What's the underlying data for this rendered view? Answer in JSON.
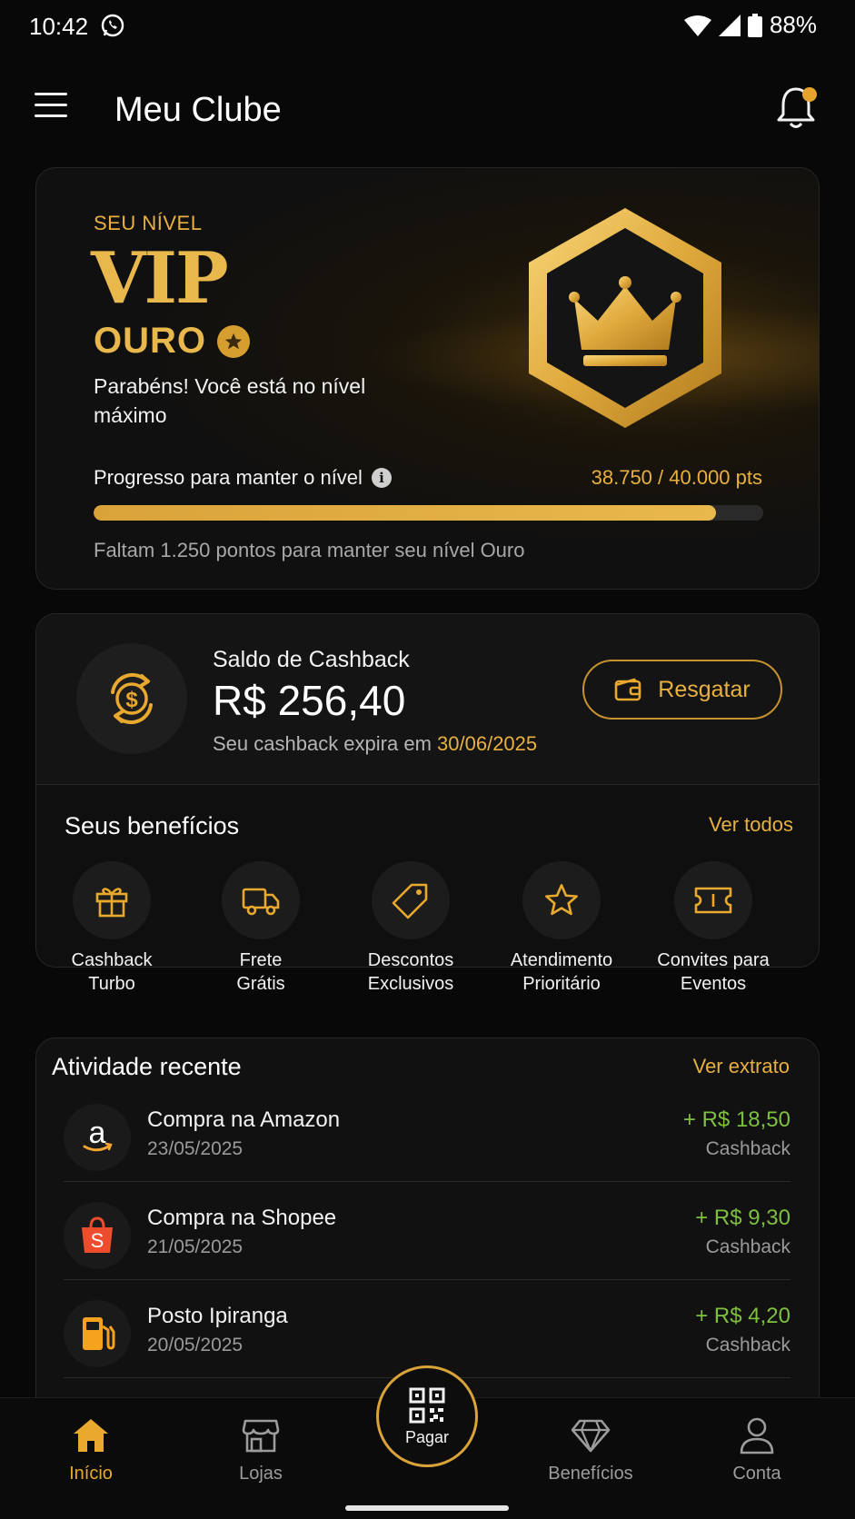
{
  "status_bar": {
    "time": "10:42",
    "battery": "88%"
  },
  "header": {
    "title": "Meu Clube"
  },
  "vip": {
    "label": "SEU NÍVEL",
    "tier": "VIP",
    "level": "OURO",
    "message": "Parabéns! Você está no nível máximo",
    "progress_label": "Progresso para manter o nível",
    "progress_value": "38.750 / 40.000 pts",
    "progress_fraction": 0.93,
    "progress_note": "Faltam 1.250 pontos para manter seu nível Ouro"
  },
  "cashback": {
    "title": "Saldo de Cashback",
    "amount": "R$ 256,40",
    "expire_text": "Seu cashback expira em",
    "expire_date": "30/06/2025",
    "redeem_label": "Resgatar"
  },
  "benefits": {
    "title": "Seus benefícios",
    "see_all": "Ver todos",
    "items": [
      {
        "line1": "Cashback",
        "line2": "Turbo",
        "icon": "gift-icon"
      },
      {
        "line1": "Frete",
        "line2": "Grátis",
        "icon": "truck-icon"
      },
      {
        "line1": "Descontos",
        "line2": "Exclusivos",
        "icon": "tag-icon"
      },
      {
        "line1": "Atendimento",
        "line2": "Prioritário",
        "icon": "star-icon"
      },
      {
        "line1": "Convites para",
        "line2": "Eventos",
        "icon": "ticket-icon"
      }
    ]
  },
  "activity": {
    "title": "Atividade recente",
    "link": "Ver extrato",
    "items": [
      {
        "name": "Compra na Amazon",
        "date": "23/05/2025",
        "amount": "+ R$ 18,50",
        "type": "Cashback",
        "icon": "amazon-logo-icon"
      },
      {
        "name": "Compra na Shopee",
        "date": "21/05/2025",
        "amount": "+ R$ 9,30",
        "type": "Cashback",
        "icon": "shopee-bag-icon"
      },
      {
        "name": "Posto Ipiranga",
        "date": "20/05/2025",
        "amount": "+ R$ 4,20",
        "type": "Cashback",
        "icon": "fuel-pump-icon"
      }
    ]
  },
  "nav": {
    "home": "Início",
    "stores": "Lojas",
    "pay": "Pagar",
    "benefits": "Benefícios",
    "account": "Conta"
  },
  "colors": {
    "accent": "#E8B040",
    "positive": "#7FBF3F",
    "background": "#080808"
  }
}
